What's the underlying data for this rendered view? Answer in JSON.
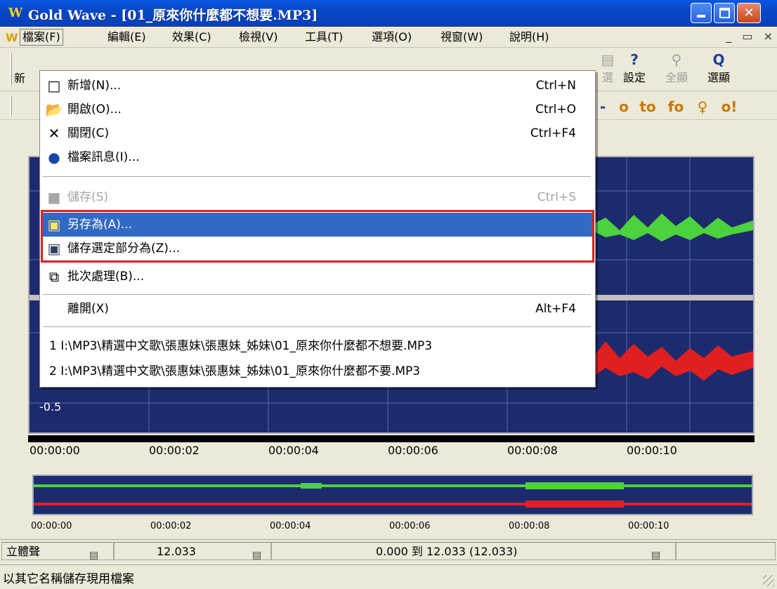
{
  "window": {
    "logo": "W",
    "title": "Gold Wave - [01_原來你什麼都不想要.MP3]"
  },
  "menubar": {
    "doc_icon": "W",
    "items": [
      "檔案(F)",
      "編輯(E)",
      "效果(C)",
      "檢視(V)",
      "工具(T)",
      "選項(O)",
      "視窗(W)",
      "說明(H)"
    ],
    "mdi_buttons": "_ ▭ ×"
  },
  "toolbar": {
    "left_partial": "新",
    "buttons": [
      {
        "icon": "選-icon",
        "label": "選",
        "glyph": "▤",
        "enabled": false
      },
      {
        "icon": "settings-icon",
        "label": "設定",
        "glyph": "?",
        "enabled": true
      },
      {
        "icon": "select-all-icon",
        "label": "全顯",
        "glyph": "⚲",
        "enabled": false
      },
      {
        "icon": "zoom-select-icon",
        "label": "選顯",
        "glyph": "Q",
        "enabled": true
      }
    ],
    "row2_glyphs": [
      "-",
      "o",
      "to",
      "fo",
      "♀",
      "o!"
    ]
  },
  "file_menu": {
    "items": [
      {
        "icon": "new-file-icon",
        "glyph": "□",
        "label": "新增(N)...",
        "shortcut": "Ctrl+N",
        "enabled": true
      },
      {
        "icon": "open-folder-icon",
        "glyph": "📂",
        "label": "開啟(O)...",
        "shortcut": "Ctrl+O",
        "enabled": true
      },
      {
        "icon": "close-icon",
        "glyph": "✕",
        "label": "關閉(C)",
        "shortcut": "Ctrl+F4",
        "enabled": true
      },
      {
        "icon": "info-icon",
        "glyph": "●",
        "label": "檔案訊息(I)...",
        "shortcut": "",
        "enabled": true
      },
      {
        "icon": "save-icon",
        "glyph": "■",
        "label": "儲存(S)",
        "shortcut": "Ctrl+S",
        "enabled": false
      },
      {
        "icon": "save-as-icon",
        "glyph": "▣",
        "label": "另存為(A)...",
        "shortcut": "",
        "enabled": true,
        "highlighted": true
      },
      {
        "icon": "save-selection-icon",
        "glyph": "▣",
        "label": "儲存選定部分為(Z)...",
        "shortcut": "",
        "enabled": true
      },
      {
        "icon": "batch-icon",
        "glyph": "⧉",
        "label": "批次處理(B)...",
        "shortcut": "",
        "enabled": true
      },
      {
        "icon": "",
        "glyph": "",
        "label": "離開(X)",
        "shortcut": "Alt+F4",
        "enabled": true
      }
    ],
    "recent": [
      "1 I:\\MP3\\精選中文歌\\張惠妹\\張惠妹_姊妹\\01_原來你什麼都不想要.MP3",
      "2 I:\\MP3\\精選中文歌\\張惠妹\\張惠妹_姊妹\\01_原來你什麼都不要.MP3"
    ]
  },
  "waveform": {
    "amplitude_label": "-0.5",
    "colors": {
      "background": "#1e2a6e",
      "left_channel": "#4cd23c",
      "right_channel": "#e02020"
    }
  },
  "timeline": {
    "labels": [
      "00:00:00",
      "00:00:02",
      "00:00:04",
      "00:00:06",
      "00:00:08",
      "00:00:10"
    ]
  },
  "statusbar": {
    "channel": "立體聲",
    "length": "12.033",
    "selection": "0.000 到 12.033 (12.033)",
    "message": "以其它名稱儲存現用檔案"
  }
}
